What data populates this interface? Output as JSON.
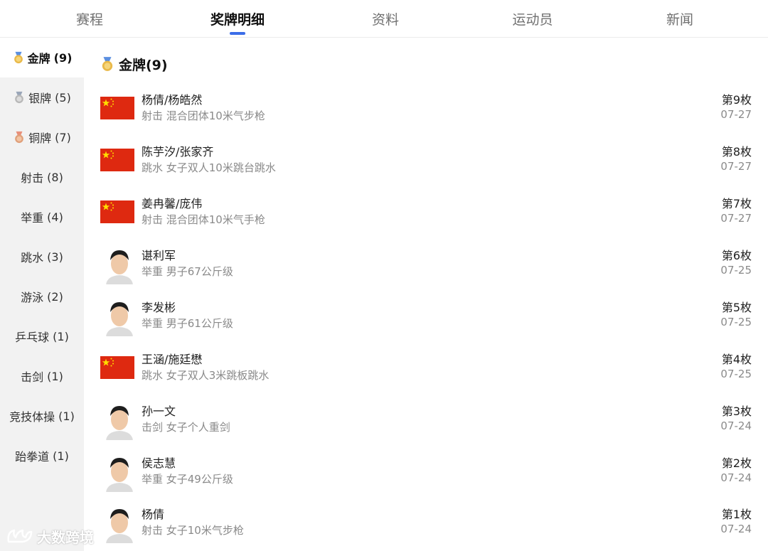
{
  "tabs": [
    {
      "label": "赛程"
    },
    {
      "label": "奖牌明细"
    },
    {
      "label": "资料"
    },
    {
      "label": "运动员"
    },
    {
      "label": "新闻"
    }
  ],
  "sidebar": {
    "items": [
      {
        "label": "金牌",
        "count": "(9)",
        "icon": "gold-medal-icon"
      },
      {
        "label": "银牌",
        "count": "(5)",
        "icon": "silver-medal-icon"
      },
      {
        "label": "铜牌",
        "count": "(7)",
        "icon": "bronze-medal-icon"
      },
      {
        "label": "射击",
        "count": "(8)"
      },
      {
        "label": "举重",
        "count": "(4)"
      },
      {
        "label": "跳水",
        "count": "(3)"
      },
      {
        "label": "游泳",
        "count": "(2)"
      },
      {
        "label": "乒乓球",
        "count": "(1)"
      },
      {
        "label": "击剑",
        "count": "(1)"
      },
      {
        "label": "竞技体操",
        "count": "(1)"
      },
      {
        "label": "跆拳道",
        "count": "(1)"
      }
    ]
  },
  "main": {
    "title": "金牌(9)",
    "medals": [
      {
        "name": "杨倩/杨皓然",
        "event": "射击 混合团体10米气步枪",
        "rank": "第9枚",
        "date": "07-27",
        "image": "china-flag-icon"
      },
      {
        "name": "陈芋汐/张家齐",
        "event": "跳水 女子双人10米跳台跳水",
        "rank": "第8枚",
        "date": "07-27",
        "image": "china-flag-icon"
      },
      {
        "name": "姜冉馨/庞伟",
        "event": "射击 混合团体10米气手枪",
        "rank": "第7枚",
        "date": "07-27",
        "image": "china-flag-icon"
      },
      {
        "name": "谌利军",
        "event": "举重 男子67公斤级",
        "rank": "第6枚",
        "date": "07-25",
        "image": "athlete-photo"
      },
      {
        "name": "李发彬",
        "event": "举重 男子61公斤级",
        "rank": "第5枚",
        "date": "07-25",
        "image": "athlete-photo"
      },
      {
        "name": "王涵/施廷懋",
        "event": "跳水 女子双人3米跳板跳水",
        "rank": "第4枚",
        "date": "07-25",
        "image": "china-flag-icon"
      },
      {
        "name": "孙一文",
        "event": "击剑 女子个人重剑",
        "rank": "第3枚",
        "date": "07-24",
        "image": "athlete-photo"
      },
      {
        "name": "侯志慧",
        "event": "举重 女子49公斤级",
        "rank": "第2枚",
        "date": "07-24",
        "image": "athlete-photo"
      },
      {
        "name": "杨倩",
        "event": "射击 女子10米气步枪",
        "rank": "第1枚",
        "date": "07-24",
        "image": "athlete-photo"
      }
    ]
  },
  "watermark": {
    "text": "大数跨境"
  },
  "colors": {
    "accent": "#3b6de8",
    "flag_red": "#de2910",
    "flag_star": "#ffde00",
    "gold": "#e9b949",
    "silver": "#b8b8b8",
    "bronze": "#e0a07a"
  }
}
